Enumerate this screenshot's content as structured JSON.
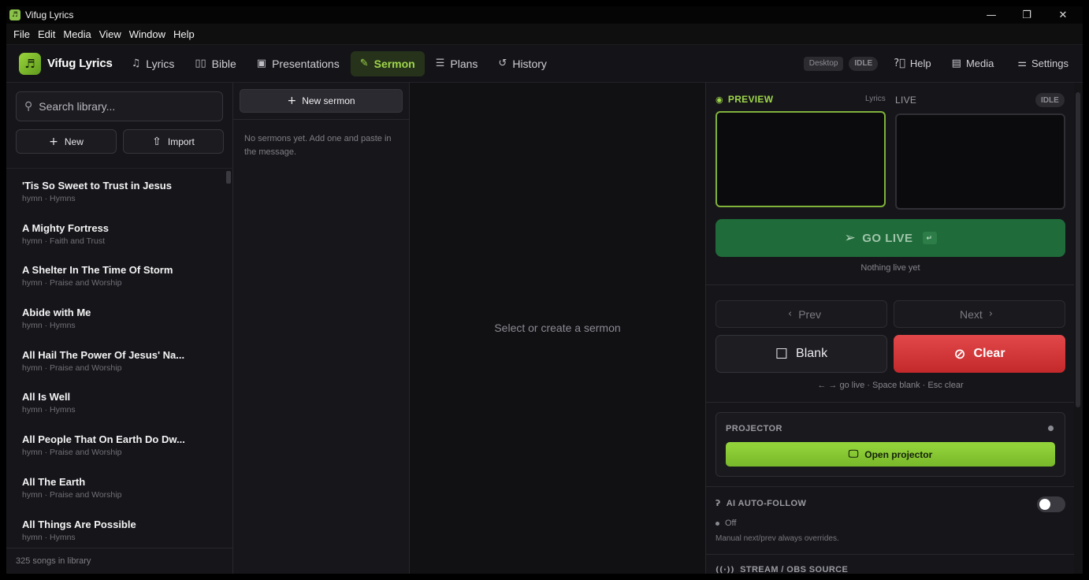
{
  "window": {
    "title": "Vifug Lyrics",
    "minimize": "—",
    "restore": "❐",
    "close": "✕"
  },
  "menu": [
    "File",
    "Edit",
    "Media",
    "View",
    "Window",
    "Help"
  ],
  "brand": {
    "name": "Vifug Lyrics",
    "icon": "music-note-icon"
  },
  "nav": {
    "tabs": [
      {
        "label": "Lyrics",
        "icon": "music-note-icon"
      },
      {
        "label": "Bible",
        "icon": "book-icon"
      },
      {
        "label": "Presentations",
        "icon": "presentation-icon"
      },
      {
        "label": "Sermon",
        "icon": "edit-icon",
        "active": true
      },
      {
        "label": "Plans",
        "icon": "checklist-icon"
      },
      {
        "label": "History",
        "icon": "history-icon"
      }
    ],
    "desktop_badge": "Desktop",
    "idle_badge": "IDLE",
    "help": "Help",
    "media": "Media",
    "settings": "Settings"
  },
  "library": {
    "search_placeholder": "Search library...",
    "new_label": "New",
    "import_label": "Import",
    "songs": [
      {
        "title": "'Tis So Sweet to Trust in Jesus",
        "meta": "hymn · Hymns"
      },
      {
        "title": "A Mighty Fortress",
        "meta": "hymn · Faith and Trust"
      },
      {
        "title": "A Shelter In The Time Of Storm",
        "meta": "hymn · Praise and Worship"
      },
      {
        "title": "Abide with Me",
        "meta": "hymn · Hymns"
      },
      {
        "title": "All Hail The Power Of Jesus' Na...",
        "meta": "hymn · Praise and Worship"
      },
      {
        "title": "All Is Well",
        "meta": "hymn · Hymns"
      },
      {
        "title": "All People That On Earth Do Dw...",
        "meta": "hymn · Praise and Worship"
      },
      {
        "title": "All The Earth",
        "meta": "hymn · Praise and Worship"
      },
      {
        "title": "All Things Are Possible",
        "meta": "hymn · Hymns"
      }
    ],
    "footer": "325 songs in library"
  },
  "sermons": {
    "new_label": "New sermon",
    "empty_text": "No sermons yet. Add one and paste in the message."
  },
  "main": {
    "empty_text": "Select or create a sermon"
  },
  "output": {
    "preview_label": "PREVIEW",
    "preview_source": "Lyrics",
    "live_label": "LIVE",
    "live_status": "IDLE",
    "go_live_label": "GO LIVE",
    "go_live_key": "↵",
    "live_status_text": "Nothing live yet",
    "prev_label": "Prev",
    "next_label": "Next",
    "blank_label": "Blank",
    "clear_label": "Clear",
    "shortcut_hint": "← → go live · Space blank · Esc clear",
    "projector_label": "PROJECTOR",
    "open_projector_label": "Open projector",
    "ai_label": "AI AUTO-FOLLOW",
    "ai_state": "Off",
    "ai_note": "Manual next/prev always overrides.",
    "stream_label": "STREAM / OBS SOURCE"
  },
  "colors": {
    "accent": "#9fd64a",
    "live_green": "#1f6b3a",
    "clear_red": "#d23a3c"
  }
}
